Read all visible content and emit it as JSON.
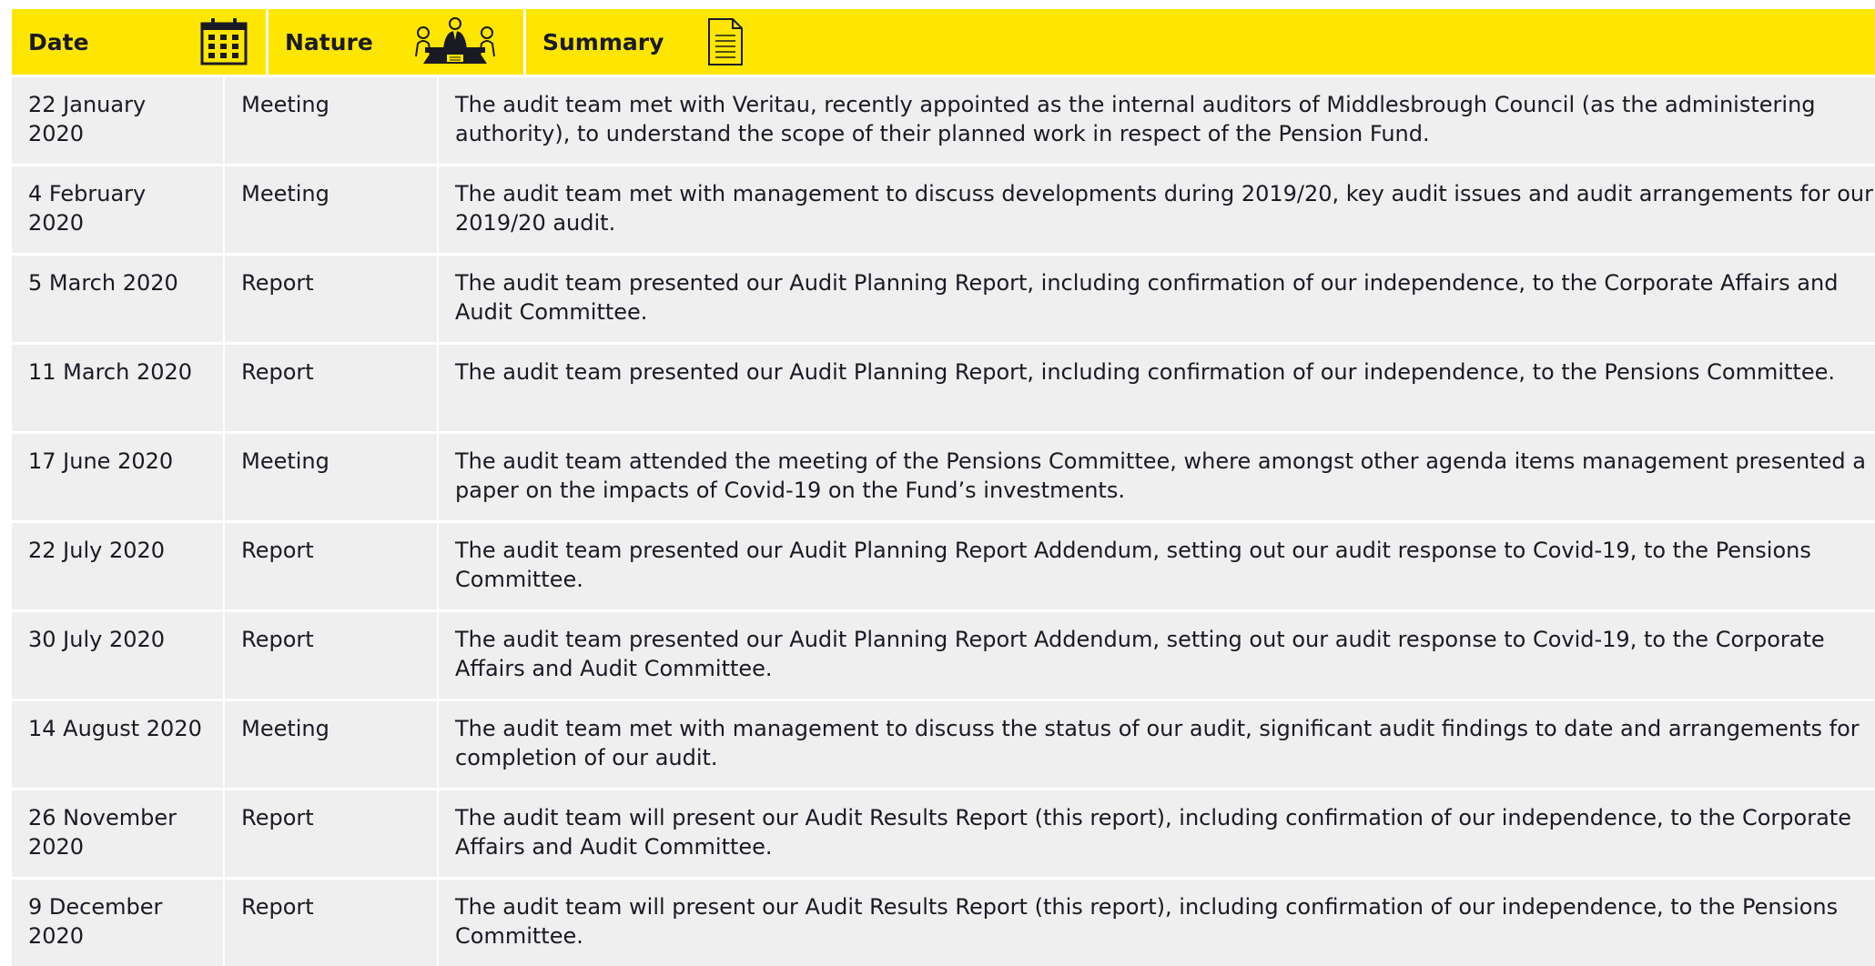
{
  "header": {
    "date_label": "Date",
    "nature_label": "Nature",
    "summary_label": "Summary",
    "date_icon": "calendar-icon",
    "nature_icon": "meeting-people-icon",
    "summary_icon": "document-icon",
    "background_color": "#ffe600"
  },
  "rows": [
    {
      "date": "22 January 2020",
      "nature": "Meeting",
      "summary": "The audit team met with Veritau, recently appointed as the internal auditors of Middlesbrough Council (as the administering authority), to understand the scope of their planned work in respect of the Pension Fund."
    },
    {
      "date": "4 February 2020",
      "nature": "Meeting",
      "summary": "The audit team met with management to discuss developments during 2019/20, key audit issues and audit arrangements for our 2019/20 audit."
    },
    {
      "date": "5 March 2020",
      "nature": "Report",
      "summary": "The audit team presented our Audit Planning Report, including confirmation of our independence, to the Corporate Affairs and Audit Committee."
    },
    {
      "date": "11 March 2020",
      "nature": "Report",
      "summary": "The audit team presented our Audit Planning Report, including confirmation of our independence, to the Pensions Committee."
    },
    {
      "date": "17 June 2020",
      "nature": "Meeting",
      "summary": "The audit team attended the meeting of the Pensions Committee, where amongst other agenda items management presented a paper on the impacts of Covid-19 on the Fund’s investments."
    },
    {
      "date": "22 July 2020",
      "nature": "Report",
      "summary": "The audit team presented our Audit Planning Report Addendum, setting out our audit response to Covid-19, to the Pensions Committee."
    },
    {
      "date": "30 July 2020",
      "nature": "Report",
      "summary": "The audit team presented our Audit Planning Report Addendum, setting out our audit response to Covid-19, to the Corporate Affairs and Audit Committee."
    },
    {
      "date": "14 August 2020",
      "nature": "Meeting",
      "summary": "The audit team met with management to discuss the status of our audit, significant audit findings to date and arrangements for completion of our audit."
    },
    {
      "date": "26 November 2020",
      "nature": "Report",
      "summary": "The audit team will present our Audit Results Report (this report), including confirmation of our independence, to the Corporate Affairs and Audit Committee."
    },
    {
      "date": "9 December 2020",
      "nature": "Report",
      "summary": "The audit team will present our Audit Results Report (this report), including confirmation of our independence, to the Pensions Committee."
    }
  ]
}
